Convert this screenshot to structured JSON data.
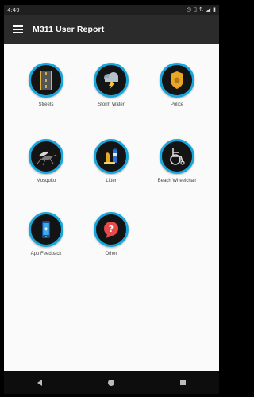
{
  "status_bar": {
    "time": "4:49",
    "icons": [
      "alarm-icon",
      "vibrate-icon",
      "network-icon",
      "signal-icon",
      "battery-icon"
    ]
  },
  "app_bar": {
    "title": "M311 User Report",
    "menu_icon": "hamburger-menu-icon"
  },
  "categories": [
    {
      "label": "Streets",
      "icon": "street-road-icon"
    },
    {
      "label": "Storm Water",
      "icon": "storm-cloud-icon"
    },
    {
      "label": "Police",
      "icon": "police-badge-icon"
    },
    {
      "label": "Mosquito",
      "icon": "mosquito-icon"
    },
    {
      "label": "Litter",
      "icon": "litter-bottle-icon"
    },
    {
      "label": "Beach Wheelchair",
      "icon": "wheelchair-icon"
    },
    {
      "label": "App Feedback",
      "icon": "phone-feedback-icon"
    },
    {
      "label": "Other",
      "icon": "question-bubble-icon"
    }
  ],
  "colors": {
    "app_bar": "#2b2b2b",
    "ring": "#18a7dc",
    "content_bg": "#fafafa",
    "nav_bar": "#0d0d0d"
  },
  "nav_bar": {
    "buttons": [
      "back-icon",
      "home-icon",
      "recent-apps-icon"
    ]
  }
}
